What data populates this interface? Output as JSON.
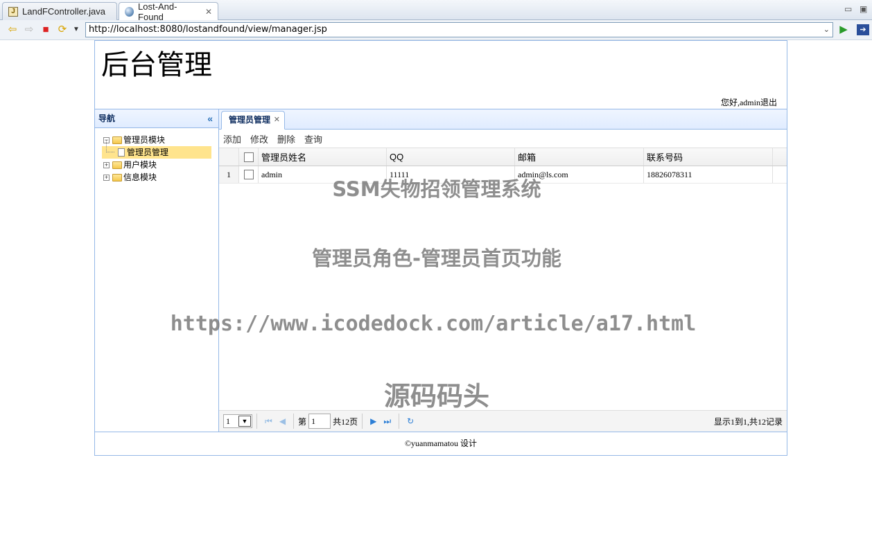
{
  "editor_tabs": [
    {
      "label": "LandFController.java"
    },
    {
      "label": "Lost-And-Found"
    }
  ],
  "browser": {
    "url": "http://localhost:8080/lostandfound/view/manager.jsp"
  },
  "header": {
    "title": "后台管理",
    "greeting": "您好,admin",
    "logout": "退出"
  },
  "nav": {
    "title": "导航",
    "tree": [
      {
        "label": "管理员模块",
        "children": [
          {
            "label": "管理员管理"
          }
        ]
      },
      {
        "label": "用户模块"
      },
      {
        "label": "信息模块"
      }
    ]
  },
  "tab": {
    "label": "管理员管理"
  },
  "toolbar": {
    "add": "添加",
    "edit": "修改",
    "delete": "删除",
    "query": "查询"
  },
  "grid": {
    "columns": [
      "管理员姓名",
      "QQ",
      "邮箱",
      "联系号码"
    ],
    "rows": [
      {
        "rownum": "1",
        "name": "admin",
        "qq": "11111",
        "email": "admin@ls.com",
        "phone": "18826078311"
      }
    ]
  },
  "pager": {
    "page_size": "1",
    "page_prefix": "第",
    "page_value": "1",
    "page_total": "共12页",
    "info": "显示1到1,共12记录"
  },
  "footer": "©yuanmamatou 设计",
  "watermarks": {
    "line1": "SSM失物招领管理系统",
    "line2": "管理员角色-管理员首页功能",
    "line3": "https://www.icodedock.com/article/a17.html",
    "line4": "源码码头"
  }
}
